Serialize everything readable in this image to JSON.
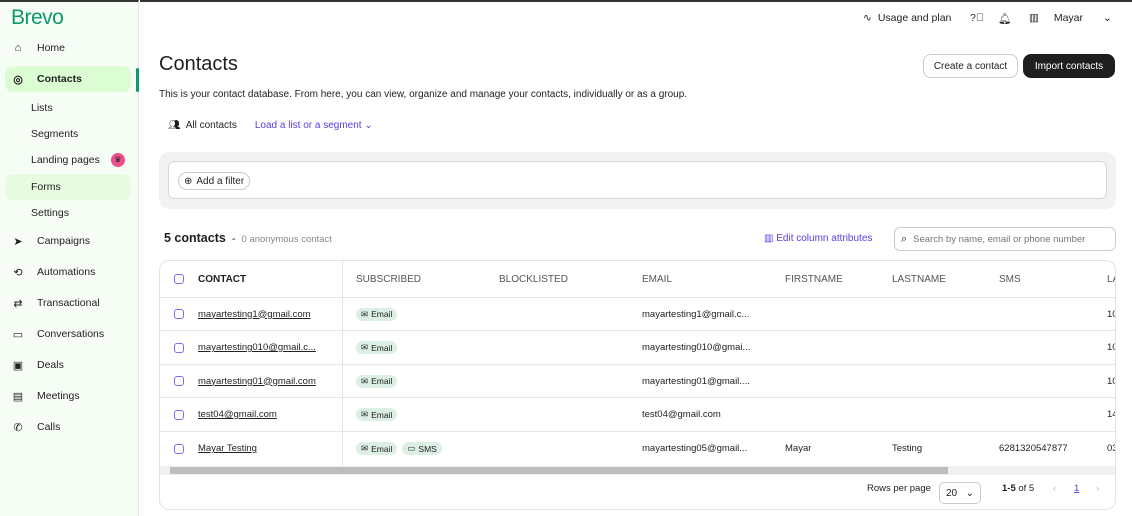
{
  "sidebar": {
    "logo": "Brevo",
    "items": [
      {
        "label": "Home",
        "icon": "home-icon",
        "glyph": "⌂"
      },
      {
        "label": "Contacts",
        "icon": "user-circle-icon",
        "glyph": "◎"
      },
      {
        "label": "Lists"
      },
      {
        "label": "Segments"
      },
      {
        "label": "Landing pages",
        "badge": "crown-icon"
      },
      {
        "label": "Forms"
      },
      {
        "label": "Settings"
      },
      {
        "label": "Campaigns",
        "icon": "send-icon",
        "glyph": "➤"
      },
      {
        "label": "Automations",
        "icon": "automation-icon",
        "glyph": "⟲"
      },
      {
        "label": "Transactional",
        "icon": "arrows-icon",
        "glyph": "⇄"
      },
      {
        "label": "Conversations",
        "icon": "chat-icon",
        "glyph": "▭"
      },
      {
        "label": "Deals",
        "icon": "deals-icon",
        "glyph": "▣"
      },
      {
        "label": "Meetings",
        "icon": "calendar-icon",
        "glyph": "▤"
      },
      {
        "label": "Calls",
        "icon": "phone-icon",
        "glyph": "✆"
      }
    ]
  },
  "topbar": {
    "usage": "Usage and plan",
    "account": "Mayar"
  },
  "page": {
    "title": "Contacts",
    "description": "This is your contact database. From here, you can view, organize and manage your contacts, individually or as a group.",
    "create": "Create a contact",
    "import": "Import contacts"
  },
  "tabs": {
    "all": "All contacts",
    "load": "Load a list or a segment"
  },
  "filter": {
    "add": "Add a filter"
  },
  "summary": {
    "count": "5 contacts",
    "sep": "-",
    "anon": "0 anonymous contact",
    "edit": "Edit column attributes",
    "search_placeholder": "Search by name, email or phone number"
  },
  "table": {
    "headers": [
      "CONTACT",
      "SUBSCRIBED",
      "BLOCKLISTED",
      "EMAIL",
      "FIRSTNAME",
      "LASTNAME",
      "SMS",
      "LA"
    ],
    "rows": [
      {
        "contact": "mayartesting1@gmail.com",
        "subs": [
          "Email"
        ],
        "email": "mayartesting1@gmail.c...",
        "first": "",
        "last": "",
        "sms": "",
        "extra": "10"
      },
      {
        "contact": "mayartesting010@gmail.c...",
        "subs": [
          "Email"
        ],
        "email": "mayartesting010@gmai...",
        "first": "",
        "last": "",
        "sms": "",
        "extra": "10"
      },
      {
        "contact": "mayartesting01@gmail.com",
        "subs": [
          "Email"
        ],
        "email": "mayartesting01@gmail....",
        "first": "",
        "last": "",
        "sms": "",
        "extra": "10"
      },
      {
        "contact": "test04@gmail.com",
        "subs": [
          "Email"
        ],
        "email": "test04@gmail.com",
        "first": "",
        "last": "",
        "sms": "",
        "extra": "14"
      },
      {
        "contact": "Mayar Testing",
        "subs": [
          "Email",
          "SMS"
        ],
        "email": "mayartesting05@gmail...",
        "first": "Mayar",
        "last": "Testing",
        "sms": "6281320547877",
        "extra": "03"
      }
    ]
  },
  "pagination": {
    "rows_label": "Rows per page",
    "rows_value": "20",
    "range": "1-5",
    "of": "of 5",
    "page": "1"
  },
  "colors": {
    "brand": "#0b996e",
    "accent": "#5a3ee0",
    "active_nav": "#dcfcd4"
  }
}
